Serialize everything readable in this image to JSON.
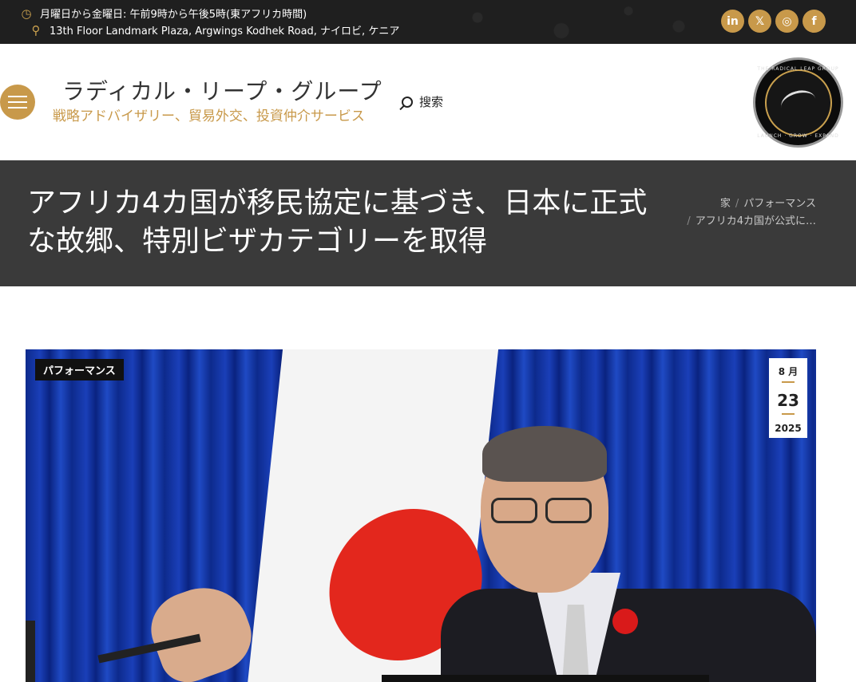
{
  "topbar": {
    "hours": "月曜日から金曜日: 午前9時から午後5時(東アフリカ時間)",
    "address": "13th Floor Landmark Plaza, Argwings Kodhek Road, ナイロビ, ケニア",
    "hours_icon": "clock-icon",
    "address_icon": "map-pin-icon",
    "social": [
      {
        "name": "linkedin-icon",
        "glyph": "in"
      },
      {
        "name": "x-twitter-icon",
        "glyph": "𝕏"
      },
      {
        "name": "instagram-icon",
        "glyph": "◎"
      },
      {
        "name": "facebook-icon",
        "glyph": "f"
      }
    ]
  },
  "header": {
    "site_title": "ラディカル・リープ・グループ",
    "tagline": "戦略アドバイザリー、貿易外交、投資仲介サービス",
    "search_label": "搜索",
    "logo_top_text": "THE RADICAL LEAP GROUP",
    "logo_bottom_text": "LAUNCH · GROW · EXPAND"
  },
  "title_band": {
    "title": "アフリカ4カ国が移民協定に基づき、日本に正式な故郷、特別ビザカテゴリーを取得",
    "breadcrumb": {
      "home": "家",
      "category": "パフォーマンス",
      "current": "アフリカ4カ国が公式に…"
    }
  },
  "post": {
    "category_badge": "パフォーマンス",
    "date": {
      "month": "8 月",
      "day": "23",
      "year": "2025"
    }
  },
  "colors": {
    "accent": "#c8994a",
    "topbar_bg": "#1f1f1f",
    "band_bg": "#3a3a3a"
  }
}
